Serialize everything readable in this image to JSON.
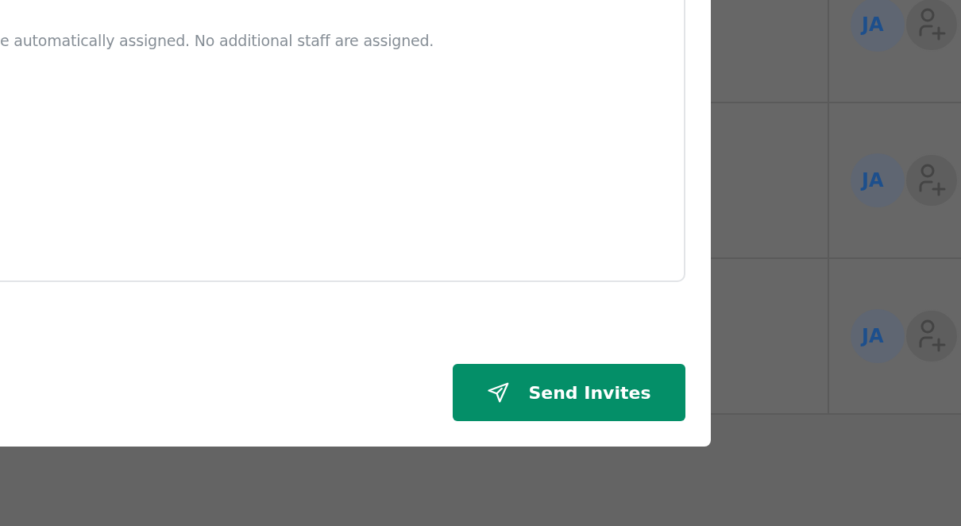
{
  "modal": {
    "description": "e automatically assigned. No additional staff are assigned.",
    "send_button": "Send Invites"
  },
  "rows": [
    {
      "avatar": "JA"
    },
    {
      "avatar": "JA"
    },
    {
      "avatar": "JA"
    }
  ]
}
